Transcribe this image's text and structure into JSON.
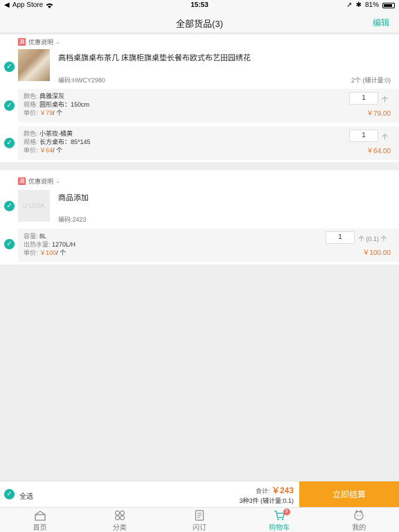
{
  "status_bar": {
    "back_label": "App Store",
    "time": "15:53",
    "battery_percent": "81%"
  },
  "nav": {
    "title": "全部货品(3)",
    "edit_label": "编辑"
  },
  "groups": [
    {
      "promo_label": "优惠说明",
      "promo_tag": "满",
      "product": {
        "title": "高档桌旗桌布茶几 床旗柜旗桌垫长餐布欧式布艺田园绣花",
        "code": "编码:HWCY2980",
        "count": "2个 (辅计量:0)"
      },
      "variants": [
        {
          "line1_label": "颜色:",
          "line1_value": "典雅深灰",
          "line2_label": "规格:",
          "line2_value": "圆形桌布：150cm",
          "price_label": "单价:",
          "price_prefix": "￥",
          "unit_price": "79",
          "price_suffix": "/ 个",
          "qty": "1",
          "qty_unit": "个",
          "total": "￥79.00"
        },
        {
          "line1_label": "颜色:",
          "line1_value": "小茶玫-橘黄",
          "line2_label": "规格:",
          "line2_value": "长方桌布：85*145",
          "price_label": "单价:",
          "price_prefix": "￥",
          "unit_price": "64",
          "price_suffix": "/ 个",
          "qty": "1",
          "qty_unit": "个",
          "total": "￥64.00"
        }
      ]
    },
    {
      "promo_label": "优惠说明",
      "promo_tag": "满",
      "product": {
        "title": "商品添加",
        "code": "编码:2423",
        "thumb_text": "U LDSK"
      },
      "variants": [
        {
          "line1_label": "容量:",
          "line1_value": "8L",
          "line2_label": "出热水量:",
          "line2_value": "1270L/H",
          "price_label": "单价:",
          "price_prefix": "￥",
          "unit_price": "100",
          "price_suffix": "/ 个",
          "qty": "1",
          "qty_unit": "个 (0.1) 个",
          "total": "￥100.00"
        }
      ]
    }
  ],
  "checkout": {
    "select_all": "全选",
    "total_label": "合计:",
    "total_amount": "￥243",
    "summary": "3种3件 (辅计量:0.1)",
    "button": "立即结算"
  },
  "tabs": [
    {
      "label": "首页",
      "icon": "home-icon"
    },
    {
      "label": "分类",
      "icon": "category-icon"
    },
    {
      "label": "闪订",
      "icon": "quick-order-icon"
    },
    {
      "label": "购物车",
      "icon": "cart-icon",
      "badge": "3",
      "active": true
    },
    {
      "label": "我的",
      "icon": "profile-icon"
    }
  ],
  "colors": {
    "accent": "#1ab7a6",
    "price": "#f07226",
    "checkout": "#f7a01b",
    "badge": "#f06a6a"
  }
}
